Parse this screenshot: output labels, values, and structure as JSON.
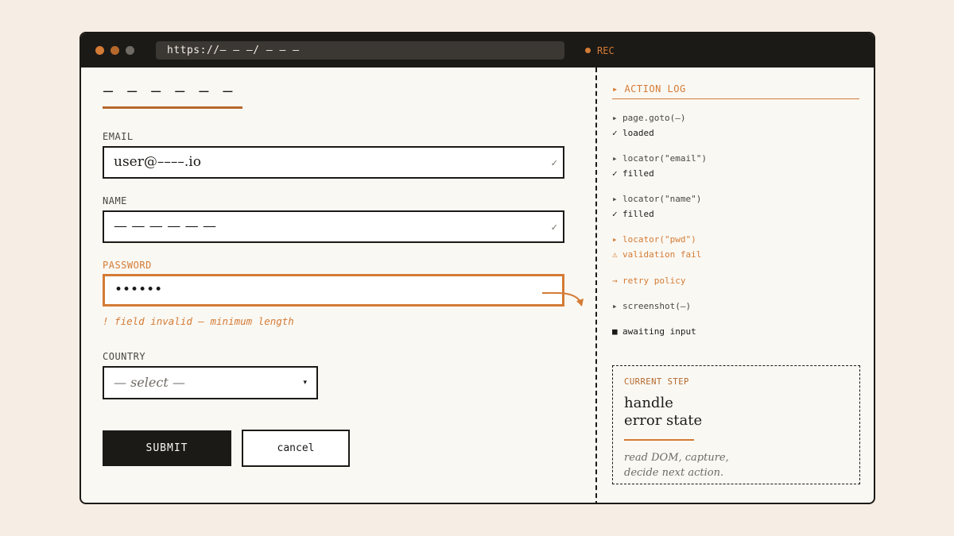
{
  "browser": {
    "url": "https://– – –/ – – –",
    "rec_label": "REC"
  },
  "form": {
    "title": "— — — — — —",
    "email": {
      "label": "EMAIL",
      "value": "user@––––.io",
      "check": "✓"
    },
    "name": {
      "label": "NAME",
      "value": "— — — — — —",
      "check": "✓"
    },
    "password": {
      "label": "PASSWORD",
      "value": "••••••",
      "error": "! field invalid — minimum length"
    },
    "country": {
      "label": "COUNTRY",
      "value": "— select —",
      "caret": "▾"
    },
    "submit_label": "SUBMIT",
    "cancel_label": "cancel"
  },
  "log": {
    "title": "▸ ACTION LOG",
    "entries": [
      {
        "prefix": "▸",
        "text": "page.goto(—)",
        "kind": "cmd"
      },
      {
        "prefix": "✓",
        "text": "loaded",
        "kind": "ok"
      },
      {
        "prefix": "▸",
        "text": "locator(\"email\")",
        "kind": "cmd"
      },
      {
        "prefix": "✓",
        "text": "filled",
        "kind": "ok"
      },
      {
        "prefix": "▸",
        "text": "locator(\"name\")",
        "kind": "cmd"
      },
      {
        "prefix": "✓",
        "text": "filled",
        "kind": "ok"
      },
      {
        "prefix": "▸",
        "text": "locator(\"pwd\")",
        "kind": "warn"
      },
      {
        "prefix": "⚠",
        "text": "validation fail",
        "kind": "warn"
      },
      {
        "prefix": "→",
        "text": "retry policy",
        "kind": "warn"
      },
      {
        "prefix": "▸",
        "text": "screenshot(—)",
        "kind": "cmd"
      },
      {
        "prefix": "■",
        "text": "awaiting input",
        "kind": "wait"
      }
    ]
  },
  "current_step": {
    "kicker": "CURRENT STEP",
    "title_line1": "handle",
    "title_line2": "error state",
    "desc_line1": "read DOM, capture,",
    "desc_line2": "decide next action."
  },
  "colors": {
    "accent": "#d47b35",
    "ink": "#1c1a17",
    "paper": "#faf8f3",
    "background": "#f6eee5"
  }
}
